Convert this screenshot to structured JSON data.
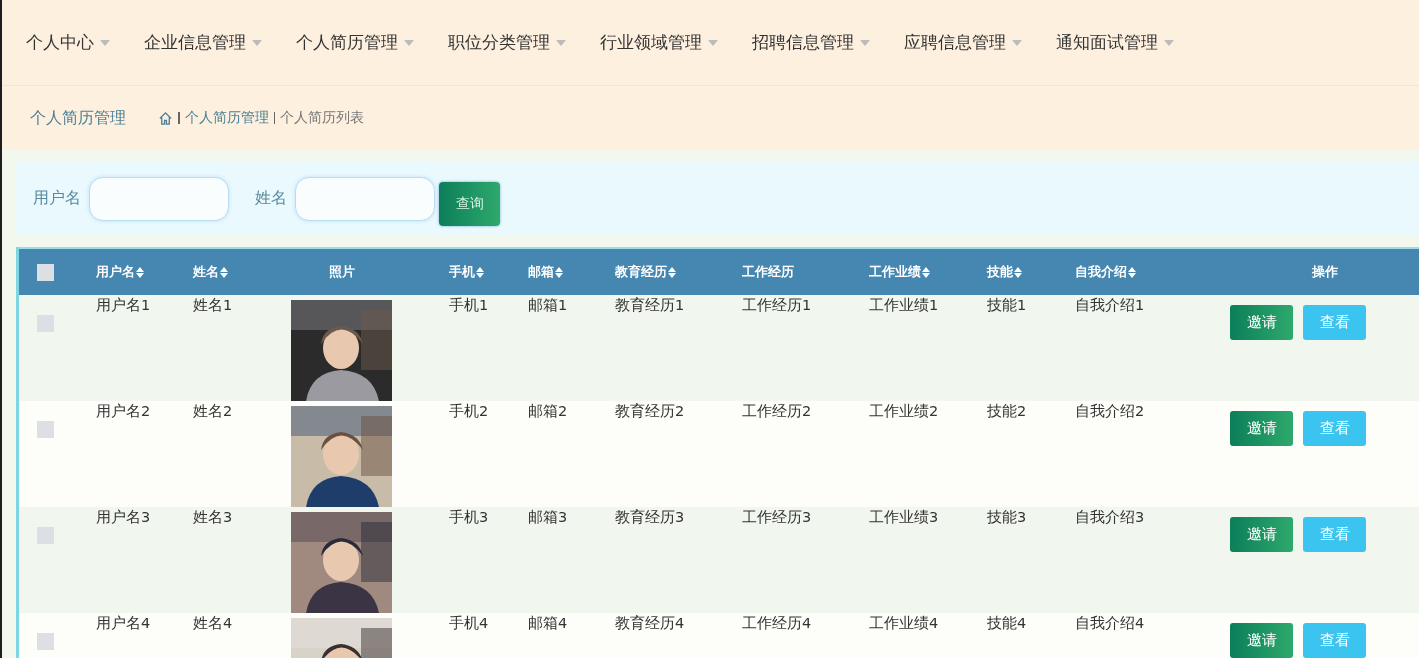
{
  "nav": [
    {
      "label": "个人中心"
    },
    {
      "label": "企业信息管理"
    },
    {
      "label": "个人简历管理"
    },
    {
      "label": "职位分类管理"
    },
    {
      "label": "行业领域管理"
    },
    {
      "label": "招聘信息管理"
    },
    {
      "label": "应聘信息管理"
    },
    {
      "label": "通知面试管理"
    }
  ],
  "breadcrumb": {
    "title": "个人简历管理",
    "items": [
      "个人简历管理",
      "个人简历列表"
    ]
  },
  "search": {
    "fields": [
      {
        "label": "用户名"
      },
      {
        "label": "姓名"
      }
    ],
    "button": "查询"
  },
  "table": {
    "select_all": {
      "checked": false
    },
    "columns": [
      {
        "label": "用户名",
        "sortable": true
      },
      {
        "label": "姓名",
        "sortable": true
      },
      {
        "label": "照片",
        "sortable": false
      },
      {
        "label": "手机",
        "sortable": true
      },
      {
        "label": "邮箱",
        "sortable": true
      },
      {
        "label": "教育经历",
        "sortable": true
      },
      {
        "label": "工作经历",
        "sortable": false
      },
      {
        "label": "工作业绩",
        "sortable": true
      },
      {
        "label": "技能",
        "sortable": true
      },
      {
        "label": "自我介绍",
        "sortable": true
      },
      {
        "label": "操作",
        "sortable": false
      }
    ],
    "rows": [
      {
        "checked": false,
        "cells": [
          "用户名1",
          "姓名1",
          {
            "kind": "picture"
          },
          "手机1",
          "邮箱1",
          "教育经历1",
          "工作经历1",
          "工作业绩1",
          "技能1",
          "自我介绍1"
        ],
        "actions": [
          {
            "label": "邀请",
            "kind": "invite"
          },
          {
            "label": "查看",
            "kind": "view"
          }
        ]
      },
      {
        "checked": false,
        "cells": [
          "用户名2",
          "姓名2",
          {
            "kind": "picture"
          },
          "手机2",
          "邮箱2",
          "教育经历2",
          "工作经历2",
          "工作业绩2",
          "技能2",
          "自我介绍2"
        ],
        "actions": [
          {
            "label": "邀请",
            "kind": "invite"
          },
          {
            "label": "查看",
            "kind": "view"
          }
        ]
      },
      {
        "checked": false,
        "cells": [
          "用户名3",
          "姓名3",
          {
            "kind": "picture"
          },
          "手机3",
          "邮箱3",
          "教育经历3",
          "工作经历3",
          "工作业绩3",
          "技能3",
          "自我介绍3"
        ],
        "actions": [
          {
            "label": "邀请",
            "kind": "invite"
          },
          {
            "label": "查看",
            "kind": "view"
          }
        ]
      },
      {
        "checked": false,
        "cells": [
          "用户名4",
          "姓名4",
          {
            "kind": "picture"
          },
          "手机4",
          "邮箱4",
          "教育经历4",
          "工作经历4",
          "工作业绩4",
          "技能4",
          "自我介绍4"
        ],
        "actions": [
          {
            "label": "邀请",
            "kind": "invite"
          },
          {
            "label": "查看",
            "kind": "view"
          }
        ]
      }
    ]
  }
}
